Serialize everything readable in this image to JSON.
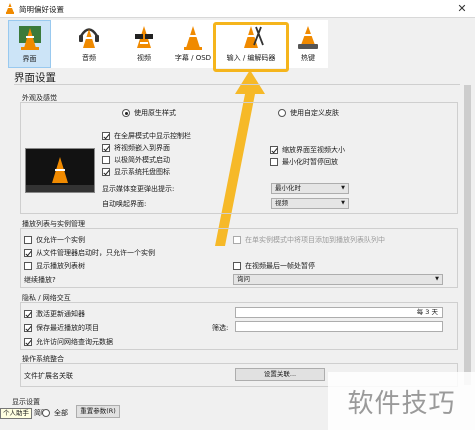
{
  "window": {
    "title": "简明偏好设置",
    "close_glyph": "✕"
  },
  "categories": [
    {
      "label": "界面",
      "icon": "vlc-cone-interface-icon",
      "selected": true
    },
    {
      "label": "音频",
      "icon": "vlc-cone-headphones-icon",
      "selected": false
    },
    {
      "label": "视频",
      "icon": "vlc-cone-glasses-icon",
      "selected": false
    },
    {
      "label": "字幕 / OSD",
      "icon": "vlc-cone-subtitle-icon",
      "selected": false
    },
    {
      "label": "输入 / 编解码器",
      "icon": "vlc-cone-input-codecs-icon",
      "selected": false
    },
    {
      "label": "热键",
      "icon": "vlc-cone-hotkeys-icon",
      "selected": false
    }
  ],
  "section_title": "界面设置",
  "look": {
    "group_title": "外观及感觉",
    "native_style": "使用原生样式",
    "custom_skin": "使用自定义皮肤",
    "options": [
      {
        "label": "在全屏模式中显示控制栏",
        "checked": true
      },
      {
        "label": "将视频嵌入到界面",
        "checked": true
      },
      {
        "label": "以极简外模式启动",
        "checked": false
      },
      {
        "label": "显示系统托盘图标",
        "checked": true
      }
    ],
    "options_right": [
      {
        "label": "缩放界面至视频大小",
        "checked": true
      },
      {
        "label": "最小化时暂停回放",
        "checked": false
      }
    ],
    "show_media_change_label": "显示媒体变更弹出提示:",
    "show_media_change_value": "最小化时",
    "auto_raise_label": "自动唤起界面:",
    "auto_raise_value": "视频"
  },
  "playlist": {
    "group_title": "播放列表与实例管理",
    "one_instance": "仅允许一个实例",
    "enqueue_single": "在单实例模式中将项目添加到播放列表队列中",
    "file_manager_one": "从文件管理器启动时，只允许一个实例",
    "show_playlist_tree": "显示播放列表树",
    "pause_last_frame": "在视频最后一帧处暂停",
    "continue_playback_label": "继续播放?",
    "continue_playback_value": "询问"
  },
  "privacy": {
    "group_title": "隐私 / 网络交互",
    "activate_updates": "激活更新通知器",
    "update_period_value": "每 3 天",
    "save_recent": "保存最近播放的项目",
    "filter_label": "筛选:",
    "allow_metadata": "允许访问网络查询元数据"
  },
  "os_integration": {
    "group_title": "操作系统整合",
    "file_ext_label": "文件扩展名关联",
    "setup_button": "设置关联..."
  },
  "footer": {
    "show_settings": "显示设置",
    "simple": "简明",
    "all": "全部",
    "reset_button": "重置参数(R)"
  },
  "tooltip": "个人助手",
  "watermark": "软件技巧",
  "colors": {
    "highlight": "#f5b51c",
    "selected_tab": "#cce4f7",
    "cone_orange": "#f08a00"
  }
}
